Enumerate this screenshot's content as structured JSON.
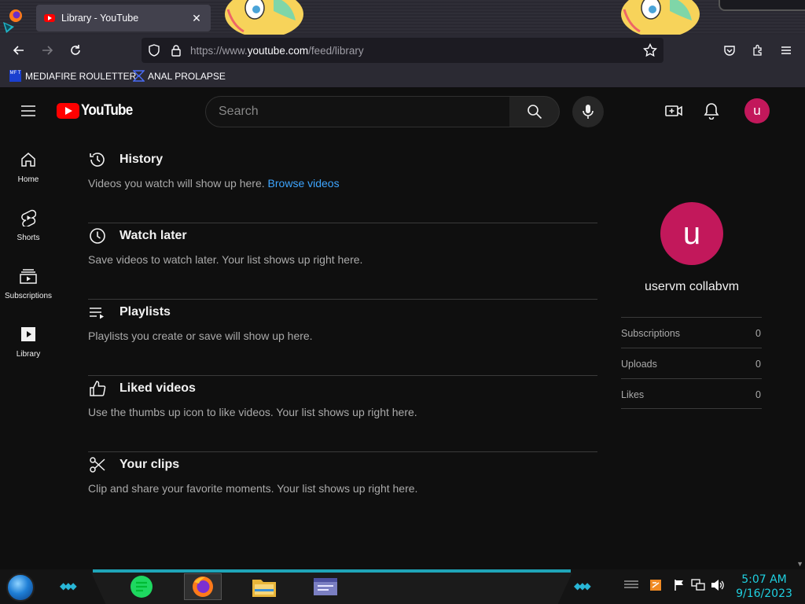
{
  "browser": {
    "tab": {
      "title": "Library - YouTube",
      "close_icon": "close-icon"
    },
    "url": {
      "prefix": "https://www.",
      "host": "youtube.com",
      "path": "/feed/library"
    },
    "bookmarks": [
      {
        "label": "MEDIAFIRE ROULETTER",
        "badge": "MF T"
      },
      {
        "label": "ANAL PROLAPSE"
      }
    ]
  },
  "youtube": {
    "logo_text": "YouTube",
    "search": {
      "placeholder": "Search"
    },
    "account_initial": "u",
    "guide": [
      {
        "label": "Home",
        "icon": "home-icon"
      },
      {
        "label": "Shorts",
        "icon": "shorts-icon"
      },
      {
        "label": "Subscriptions",
        "icon": "subscriptions-icon"
      },
      {
        "label": "Library",
        "icon": "library-icon"
      }
    ],
    "sections": [
      {
        "title": "History",
        "desc": "Videos you watch will show up here.",
        "link": "Browse videos",
        "icon": "history-icon"
      },
      {
        "title": "Watch later",
        "desc": "Save videos to watch later. Your list shows up right here.",
        "icon": "clock-icon"
      },
      {
        "title": "Playlists",
        "desc": "Playlists you create or save will show up here.",
        "icon": "playlist-icon"
      },
      {
        "title": "Liked videos",
        "desc": "Use the thumbs up icon to like videos. Your list shows up right here.",
        "icon": "thumbs-up-icon"
      },
      {
        "title": "Your clips",
        "desc": "Clip and share your favorite moments. Your list shows up right here.",
        "icon": "scissors-icon"
      }
    ],
    "channel": {
      "initial": "u",
      "name": "uservm collabvm",
      "stats": [
        {
          "label": "Subscriptions",
          "value": "0"
        },
        {
          "label": "Uploads",
          "value": "0"
        },
        {
          "label": "Likes",
          "value": "0"
        }
      ]
    }
  },
  "taskbar": {
    "time": "5:07 AM",
    "date": "9/16/2023",
    "accent_color": "#1fa5b8"
  },
  "colors": {
    "yt_red": "#ff0000",
    "avatar": "#c2185b",
    "link": "#3ea6ff",
    "background": "#0f0f0f"
  }
}
